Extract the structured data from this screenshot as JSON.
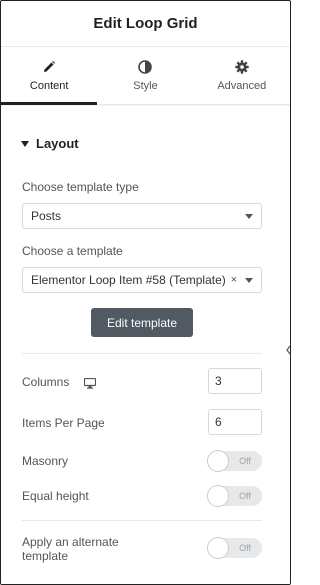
{
  "header": {
    "title": "Edit Loop Grid"
  },
  "tabs": [
    {
      "label": "Content",
      "icon": "pencil-icon",
      "active": true
    },
    {
      "label": "Style",
      "icon": "contrast-icon",
      "active": false
    },
    {
      "label": "Advanced",
      "icon": "gear-icon",
      "active": false
    }
  ],
  "layout": {
    "section_title": "Layout",
    "template_type_label": "Choose template type",
    "template_type_value": "Posts",
    "template_label": "Choose a template",
    "template_value": "Elementor Loop Item #58 (Template)",
    "clear_symbol": "×",
    "edit_button": "Edit template",
    "columns_label": "Columns",
    "columns_value": "3",
    "items_per_page_label": "Items Per Page",
    "items_per_page_value": "6",
    "masonry_label": "Masonry",
    "masonry_state": "Off",
    "equal_height_label": "Equal height",
    "equal_height_state": "Off",
    "alternate_label": "Apply an alternate template",
    "alternate_state": "Off"
  },
  "colors": {
    "accent_dark": "#1f2124",
    "button_bg": "#515962",
    "border": "#d5d8dc"
  }
}
